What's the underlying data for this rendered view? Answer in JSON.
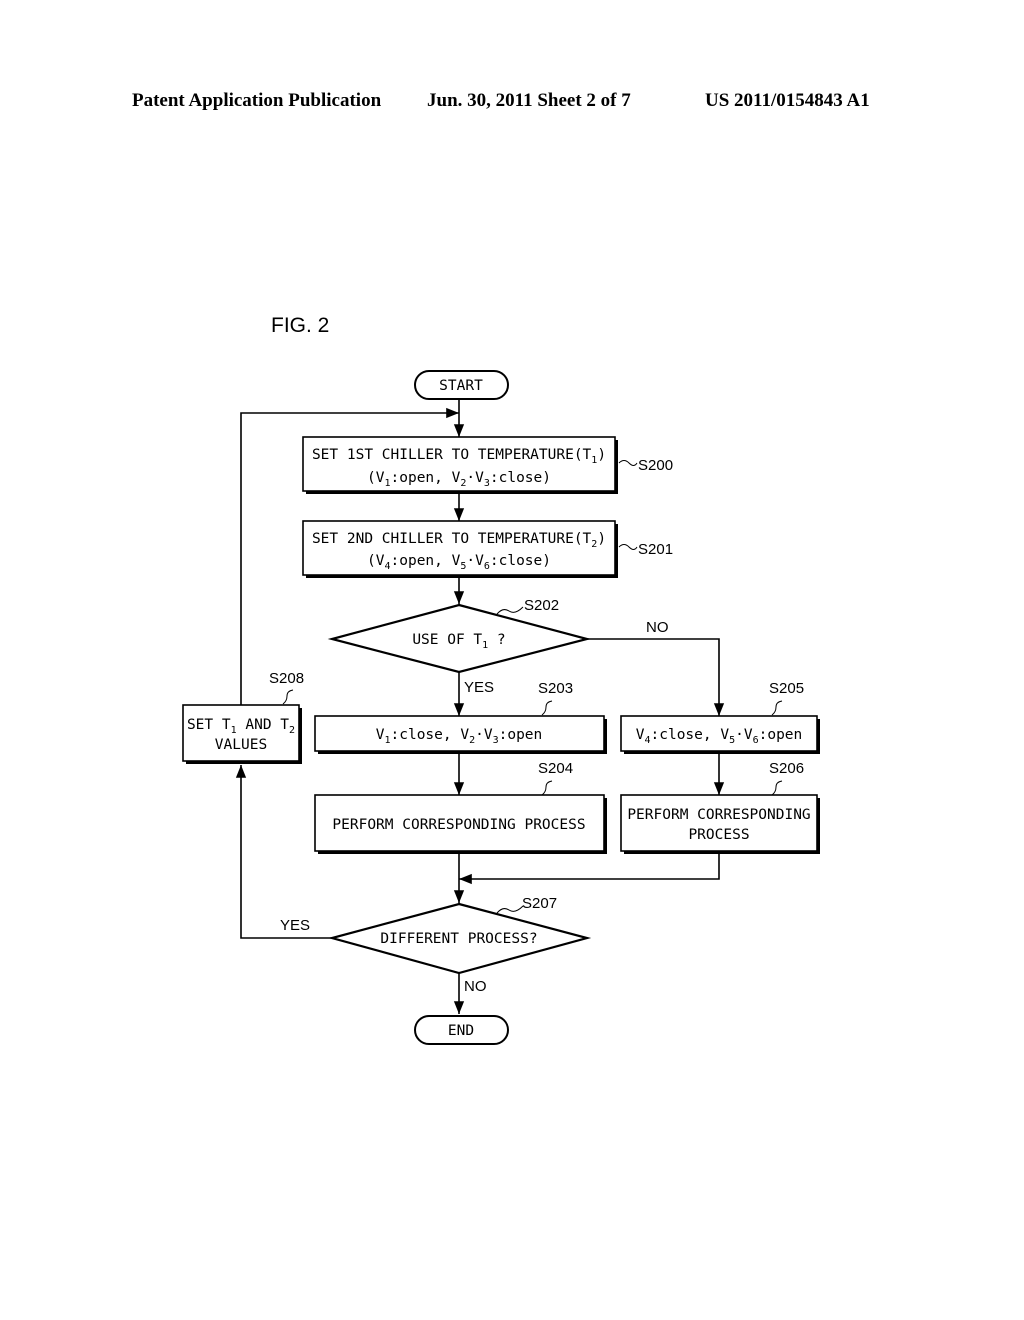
{
  "header": {
    "left": "Patent Application Publication",
    "middle": "Jun. 30, 2011  Sheet 2 of 7",
    "right": "US 2011/0154843 A1"
  },
  "figure_label": "FIG. 2",
  "flowchart": {
    "start": "START",
    "end": "END",
    "steps": {
      "s200": {
        "ref": "S200",
        "line1": "SET 1ST CHILLER TO TEMPERATURE(T",
        "line1_sub": "1",
        "line1_end": ")",
        "line2": "(V1:open, V2·V3:close)"
      },
      "s201": {
        "ref": "S201",
        "line1": "SET 2ND CHILLER TO TEMPERATURE(T",
        "line1_sub": "2",
        "line1_end": ")",
        "line2": "(V4:open, V5·V6:close)"
      },
      "s202": {
        "ref": "S202",
        "text": "USE OF T",
        "text_sub": "1",
        "text_end": " ?",
        "yes": "YES",
        "no": "NO"
      },
      "s203": {
        "ref": "S203",
        "text": "V1:close, V2·V3:open"
      },
      "s204": {
        "ref": "S204",
        "text": "PERFORM CORRESPONDING PROCESS"
      },
      "s205": {
        "ref": "S205",
        "text": "V4:close, V5·V6:open"
      },
      "s206": {
        "ref": "S206",
        "line1": "PERFORM CORRESPONDING",
        "line2": "PROCESS"
      },
      "s207": {
        "ref": "S207",
        "text": "DIFFERENT PROCESS?",
        "yes": "YES",
        "no": "NO"
      },
      "s208": {
        "ref": "S208",
        "line1": "SET T1 AND T2",
        "line2": "VALUES"
      }
    }
  }
}
